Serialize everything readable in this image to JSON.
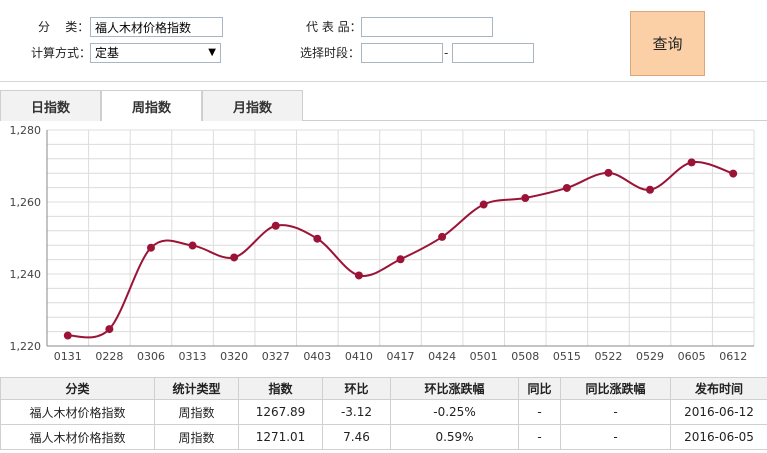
{
  "form": {
    "category_label": "分    类：",
    "category_value": "福人木材价格指数",
    "method_label": "计算方式：",
    "method_value": "定基",
    "representative_label": "代 表 品：",
    "representative_value": "",
    "period_label": "选择时段：",
    "period_start": "",
    "period_end": "",
    "period_sep": "-",
    "query_label": "查询"
  },
  "tabs": [
    {
      "label": "日指数",
      "active": false
    },
    {
      "label": "周指数",
      "active": true
    },
    {
      "label": "月指数",
      "active": false
    }
  ],
  "colors": {
    "line": "#9b1437",
    "grid": "#dcdcdc",
    "negative": "#2a9a2a",
    "positive": "#e0202a",
    "query_button": "#fbd0a7"
  },
  "chart_data": {
    "type": "line",
    "categories": [
      "0131",
      "0228",
      "0306",
      "0313",
      "0320",
      "0327",
      "0403",
      "0410",
      "0417",
      "0424",
      "0501",
      "0508",
      "0515",
      "0522",
      "0529",
      "0605",
      "0612"
    ],
    "series": [
      {
        "values": [
          1222.9,
          1224.7,
          1247.3,
          1247.9,
          1244.6,
          1253.4,
          1249.8,
          1239.6,
          1244.1,
          1250.3,
          1259.3,
          1261.1,
          1263.9,
          1268.1,
          1263.4,
          1271.01,
          1267.89
        ]
      }
    ],
    "ylim": [
      1220,
      1280
    ],
    "yticks": [
      "1,220",
      "1,240",
      "1,260",
      "1,280"
    ],
    "ytick_values": [
      1220,
      1240,
      1260,
      1280
    ],
    "grid": true,
    "legend": "none"
  },
  "table": {
    "headers": [
      "分类",
      "统计类型",
      "指数",
      "环比",
      "环比涨跌幅",
      "同比",
      "同比涨跌幅",
      "发布时间"
    ],
    "rows": [
      {
        "category": "福人木材价格指数",
        "type": "周指数",
        "index": "1267.89",
        "mom": "-3.12",
        "mom_pct": "-0.25%",
        "yoy": "-",
        "yoy_pct": "-",
        "date": "2016-06-12",
        "trend": "neg"
      },
      {
        "category": "福人木材价格指数",
        "type": "周指数",
        "index": "1271.01",
        "mom": "7.46",
        "mom_pct": "0.59%",
        "yoy": "-",
        "yoy_pct": "-",
        "date": "2016-06-05",
        "trend": "pos"
      }
    ]
  }
}
